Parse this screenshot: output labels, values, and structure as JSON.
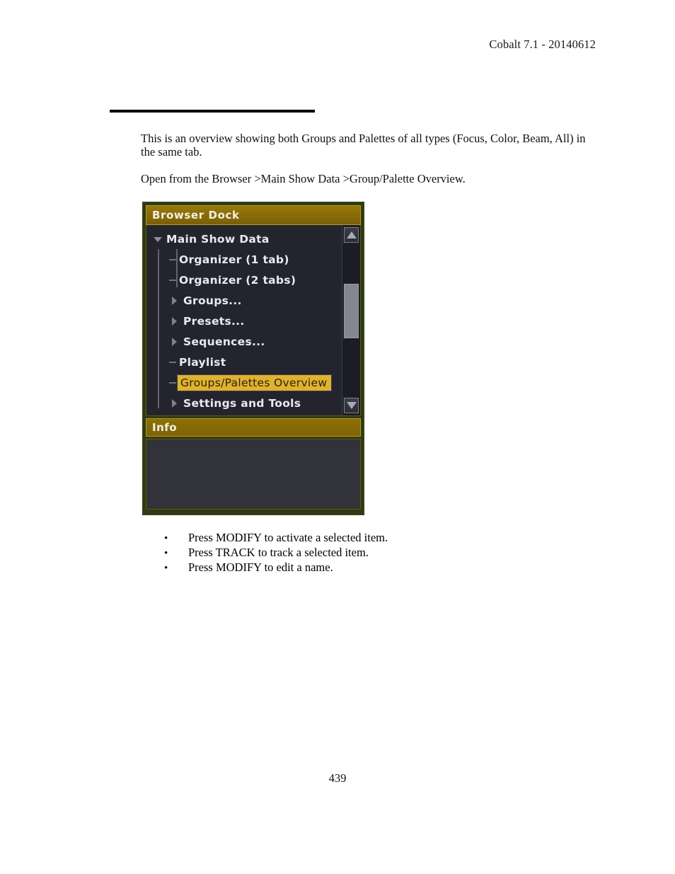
{
  "page": {
    "header": "Cobalt 7.1 - 20140612",
    "number": "439"
  },
  "content": {
    "paragraph_1": "This is an overview showing both Groups and Palettes of all types (Focus, Color, Beam, All) in the same tab.",
    "paragraph_2": "Open from the Browser >Main Show Data >Group/Palette Overview."
  },
  "dock": {
    "title": "Browser Dock",
    "info_title": "Info",
    "info_body_text": "",
    "colors": {
      "title_bar": "#8a6c07",
      "border": "#6a5405",
      "outer_edge": "#313f18",
      "tree_background": "#23242e",
      "info_background": "#32323a",
      "selection": "#e0b22e",
      "selection_text": "#2a2413",
      "label_text": "#e9eaf0"
    },
    "tree": [
      {
        "label": "Main Show Data",
        "level": 0,
        "marker": "twisty-down",
        "selected": false
      },
      {
        "label": "Organizer (1 tab)",
        "level": 1,
        "marker": "leaf-tick",
        "selected": false
      },
      {
        "label": "Organizer (2 tabs)",
        "level": 1,
        "marker": "leaf-tick",
        "selected": false
      },
      {
        "label": "Groups...",
        "level": 1,
        "marker": "twisty-right",
        "selected": false
      },
      {
        "label": "Presets...",
        "level": 1,
        "marker": "twisty-right",
        "selected": false
      },
      {
        "label": "Sequences...",
        "level": 1,
        "marker": "twisty-right",
        "selected": false
      },
      {
        "label": "Playlist",
        "level": 1,
        "marker": "leaf-tick",
        "selected": false
      },
      {
        "label": "Groups/Palettes Overview",
        "level": 1,
        "marker": "leaf-tick",
        "selected": true
      },
      {
        "label": "Settings and Tools",
        "level": 1,
        "marker": "twisty-right",
        "selected": false
      }
    ],
    "scrollbar": {
      "up_arrow": "scroll-up-arrow",
      "down_arrow": "scroll-down-arrow",
      "thumb_top_pct": 26,
      "thumb_height_pct": 36
    }
  },
  "bullets": [
    {
      "marker": "•",
      "text": "Press MODIFY to activate a selected item."
    },
    {
      "marker": "•",
      "text": "Press TRACK to track a selected item."
    },
    {
      "marker": "•",
      "text": "Press MODIFY to edit a name."
    }
  ]
}
